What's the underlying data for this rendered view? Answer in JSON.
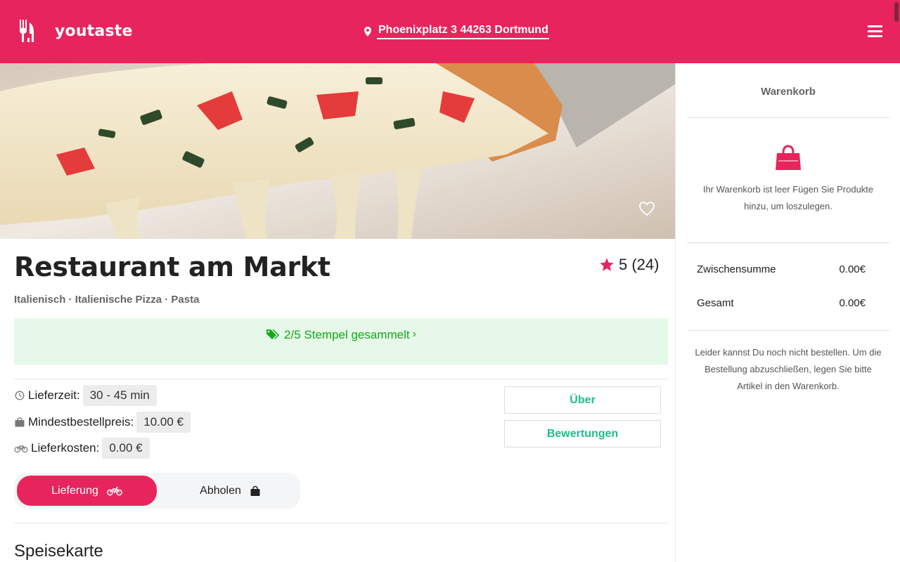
{
  "header": {
    "logo_text": "youtaste",
    "address": "Phoenixplatz 3 44263 Dortmund",
    "icons": {
      "logo": "fork-logo-icon",
      "address": "map-pin-icon",
      "menu": "hamburger-menu-icon"
    }
  },
  "hero": {
    "favorite_icon": "heart-outline-icon"
  },
  "restaurant": {
    "name": "Restaurant am Markt",
    "rating": "5 (24)",
    "cuisine": "Italienisch · Italienische Pizza · Pasta"
  },
  "stamps": {
    "label": "2/5 Stempel gesammelt",
    "chevron": "›"
  },
  "details": {
    "delivery_time": {
      "label": "Lieferzeit:",
      "value": "30 - 45 min",
      "icon": "clock-icon"
    },
    "min_order": {
      "label": "Mindestbestellpreis:",
      "value": "10.00 €",
      "icon": "shopping-bag-icon"
    },
    "delivery_cost": {
      "label": "Lieferkosten:",
      "value": "0.00 €",
      "icon": "bicycle-icon"
    }
  },
  "buttons": {
    "about": "Über",
    "reviews": "Bewertungen"
  },
  "order_mode": {
    "delivery": "Lieferung",
    "pickup": "Abholen",
    "selected": "Lieferung"
  },
  "menu": {
    "title": "Speisekarte"
  },
  "cart": {
    "title": "Warenkorb",
    "empty_text": "Ihr Warenkorb ist leer Fügen Sie Produkte hinzu, um loszulegen.",
    "subtotal_label": "Zwischensumme",
    "subtotal_value": "0.00€",
    "total_label": "Gesamt",
    "total_value": "0.00€",
    "note": "Leider kannst Du noch nicht bestellen. Um die Bestellung abzuschließen, legen Sie bitte Artikel in den Warenkorb."
  },
  "colors": {
    "brand": "#e8245c",
    "accent_green": "#1ebe88",
    "stamp_green": "#12a81a",
    "stamp_bg": "#e6f9e8"
  }
}
